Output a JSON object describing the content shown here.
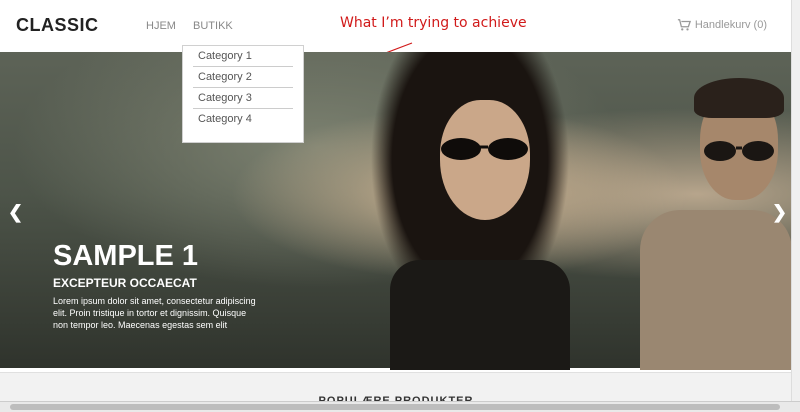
{
  "header": {
    "logo": "CLASSIC",
    "nav": [
      "HJEM",
      "BUTIKK"
    ],
    "annotation": "What I’m trying to achieve",
    "cart_label": "Handlekurv (0)"
  },
  "dropdown": {
    "items": [
      "Category 1",
      "Category 2",
      "Category 3",
      "Category 4"
    ]
  },
  "slide": {
    "title": "SAMPLE 1",
    "subtitle": "EXCEPTEUR OCCAECAT",
    "text": "Lorem ipsum dolor sit amet, consectetur adipiscing elit. Proin tristique in tortor et dignissim. Quisque non tempor leo. Maecenas egestas sem elit"
  },
  "section": {
    "title": "POPULÆRE PRODUKTER"
  },
  "colors": {
    "annotation": "#d11a1a",
    "text": "#ffffff"
  }
}
